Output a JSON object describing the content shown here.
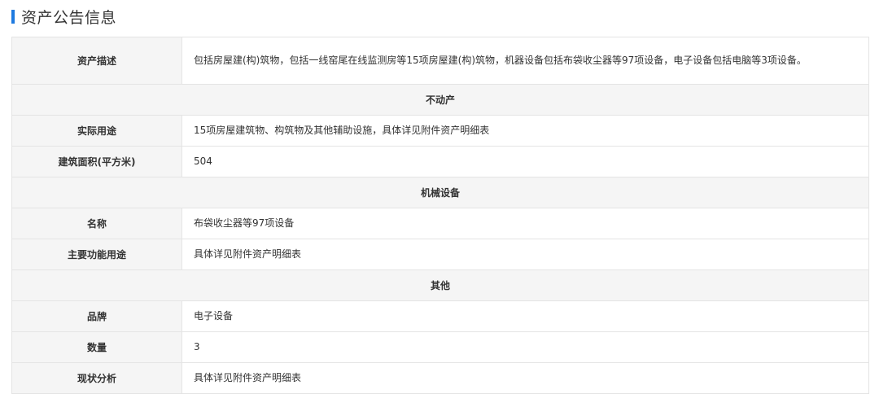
{
  "header": {
    "title": "资产公告信息",
    "accent_color": "#1e7ae0"
  },
  "table": {
    "asset_description": {
      "label": "资产描述",
      "value": "包括房屋建(构)筑物，包括一线窑尾在线监测房等15项房屋建(构)筑物，机器设备包括布袋收尘器等97项设备，电子设备包括电脑等3项设备。"
    },
    "real_estate": {
      "group_title": "不动产",
      "actual_use": {
        "label": "实际用途",
        "value": "15项房屋建筑物、构筑物及其他辅助设施，具体详见附件资产明细表"
      },
      "building_area": {
        "label": "建筑面积(平方米)",
        "value": "504"
      }
    },
    "machinery": {
      "group_title": "机械设备",
      "name": {
        "label": "名称",
        "value": "布袋收尘器等97项设备"
      },
      "main_function": {
        "label": "主要功能用途",
        "value": "具体详见附件资产明细表"
      }
    },
    "other": {
      "group_title": "其他",
      "brand": {
        "label": "品牌",
        "value": "电子设备"
      },
      "quantity": {
        "label": "数量",
        "value": "3"
      },
      "condition": {
        "label": "现状分析",
        "value": "具体详见附件资产明细表"
      }
    }
  }
}
